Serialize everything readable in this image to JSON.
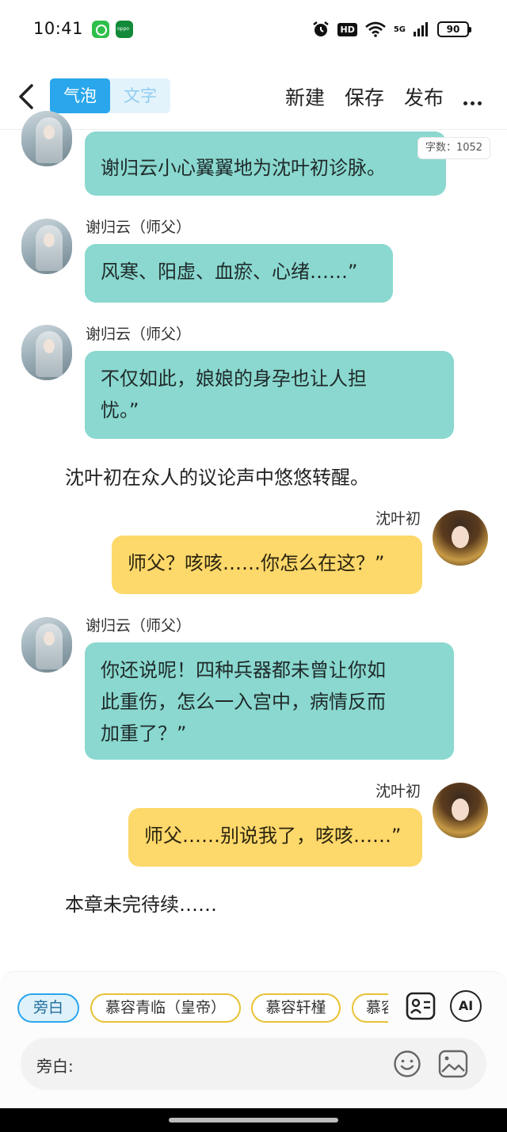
{
  "status_bar": {
    "time": "10:41",
    "network": "5G",
    "hd": "HD",
    "battery": "90"
  },
  "header": {
    "back_icon": "chevron-left-icon",
    "tabs": [
      {
        "label": "气泡",
        "active": true
      },
      {
        "label": "文字",
        "active": false
      }
    ],
    "actions": {
      "new": "新建",
      "save": "保存",
      "publish": "发布",
      "more_icon": "more-dots-icon"
    }
  },
  "word_count": "字数：1052",
  "messages": [
    {
      "type": "left",
      "speaker": "",
      "text": "谢归云小心翼翼地为沈叶初诊脉。"
    },
    {
      "type": "left",
      "speaker": "谢归云（师父）",
      "text": "风寒、阳虚、血瘀、心绪……”"
    },
    {
      "type": "left",
      "speaker": "谢归云（师父）",
      "text_lines": [
        "不仅如此，娘娘的身孕也让人担",
        "忧。”"
      ]
    },
    {
      "type": "narration",
      "text": "沈叶初在众人的议论声中悠悠转醒。"
    },
    {
      "type": "right",
      "speaker": "沈叶初",
      "text": "师父？咳咳……你怎么在这？”"
    },
    {
      "type": "left",
      "speaker": "谢归云（师父）",
      "text_lines": [
        "你还说呢！四种兵器都未曾让你如",
        "此重伤，怎么一入宫中，病情反而",
        "加重了？”"
      ]
    },
    {
      "type": "right",
      "speaker": "沈叶初",
      "text": "师父……别说我了，咳咳……”"
    },
    {
      "type": "narration",
      "text": "本章未完待续……"
    }
  ],
  "colors": {
    "teal_bubble": "#8ad8cf",
    "yellow_bubble": "#fdd86a",
    "accent": "#2aa6ec"
  },
  "roles": [
    {
      "label": "旁白",
      "active": true
    },
    {
      "label": "慕容青临（皇帝）",
      "active": false
    },
    {
      "label": "慕容轩槿",
      "active": false
    },
    {
      "label": "慕容",
      "active": false
    }
  ],
  "role_tools": {
    "contacts_icon": "contact-card-icon",
    "ai_label": "AI"
  },
  "input": {
    "label": "旁白:",
    "emoji_icon": "smiley-icon",
    "image_icon": "image-icon"
  }
}
